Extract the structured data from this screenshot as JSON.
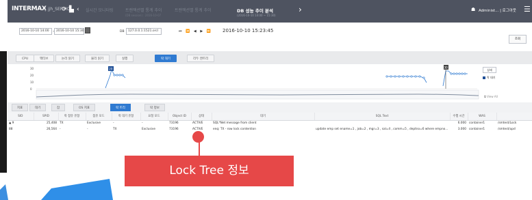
{
  "header": {
    "logo": "INTERMAX",
    "service": "jjh_SERVIC...",
    "breadcrumbs": [
      {
        "label": "실시간 모니터링",
        "sub": ""
      },
      {
        "label": "트랜잭션별 통계 추이",
        "sub": "(DB session) : 2016-10-07"
      },
      {
        "label": "트랜잭션별 통계 추이",
        "sub": ""
      },
      {
        "label": "DB 성능 추이 분석",
        "sub": "(2016-10-10 14:00 ~ 15:30)"
      }
    ],
    "user": "Administ... | 로그아웃"
  },
  "filters": {
    "from": "2016-10-10 14:00",
    "to": "2016-10-10 15:30",
    "db_label": "DB",
    "db_value": "127.0.0.1:1521.orcl",
    "nav_buttons": "⏮ ⏪ ◀ ▶ ⏩",
    "timestamp": "2016-10-10 15:23:45",
    "search_label": "조회"
  },
  "main_tabs": [
    {
      "label": "CPU",
      "active": false
    },
    {
      "label": "액티브",
      "active": false
    },
    {
      "label": "논리 읽기",
      "active": false
    },
    {
      "label": "물리 읽기",
      "active": false
    },
    {
      "label": "실행",
      "active": false
    },
    {
      "label": "락 대기",
      "active": true
    },
    {
      "label": "리두 엔트리",
      "active": false
    }
  ],
  "chart": {
    "y_ticks": [
      "30",
      "20",
      "10",
      "0"
    ],
    "markers": [
      "20",
      "30"
    ],
    "legend_button": "상세",
    "legend_item": "락 대기",
    "view_all": "View All",
    "colors": {
      "line": "#1f4f96",
      "series": "#2f7ad1",
      "overview": "#9aa7b8"
    }
  },
  "sub_tabs": [
    {
      "label": "지표",
      "active": false
    },
    {
      "label": "대기",
      "active": false
    },
    {
      "label": "잠",
      "active": false
    },
    {
      "label": "OS 지표",
      "active": false
    },
    {
      "label": "락 트리",
      "active": true
    },
    {
      "label": "락 정보",
      "active": false
    }
  ],
  "table": {
    "columns": [
      "SID",
      "SPID",
      "락 점유 유형",
      "점유 모드",
      "락 대기 유형",
      "요청 모드",
      "Object ID",
      "상태",
      "대기",
      "SQL Text",
      "수행 시간",
      "WAS",
      ""
    ],
    "rows": [
      [
        "▲ 9",
        "25,408",
        "TX",
        "Exclusive",
        "-",
        "-",
        "73196",
        "ACTIVE",
        "SQL*Net message from client",
        "",
        "6.000",
        "container1",
        "/smtest/Lock"
      ],
      [
        "88",
        "26,564",
        "-",
        "-",
        "TX",
        "Exclusive",
        "73196",
        "ACTIVE",
        "enq: TX - row lock contention",
        "update emp set ename=1 , job=2 , mgr=3 , sal=4 , comm=5 , deptno=6 where empno...",
        "3.000",
        "container1",
        "/smtest/upd"
      ]
    ]
  },
  "callout": "Lock Tree 정보"
}
